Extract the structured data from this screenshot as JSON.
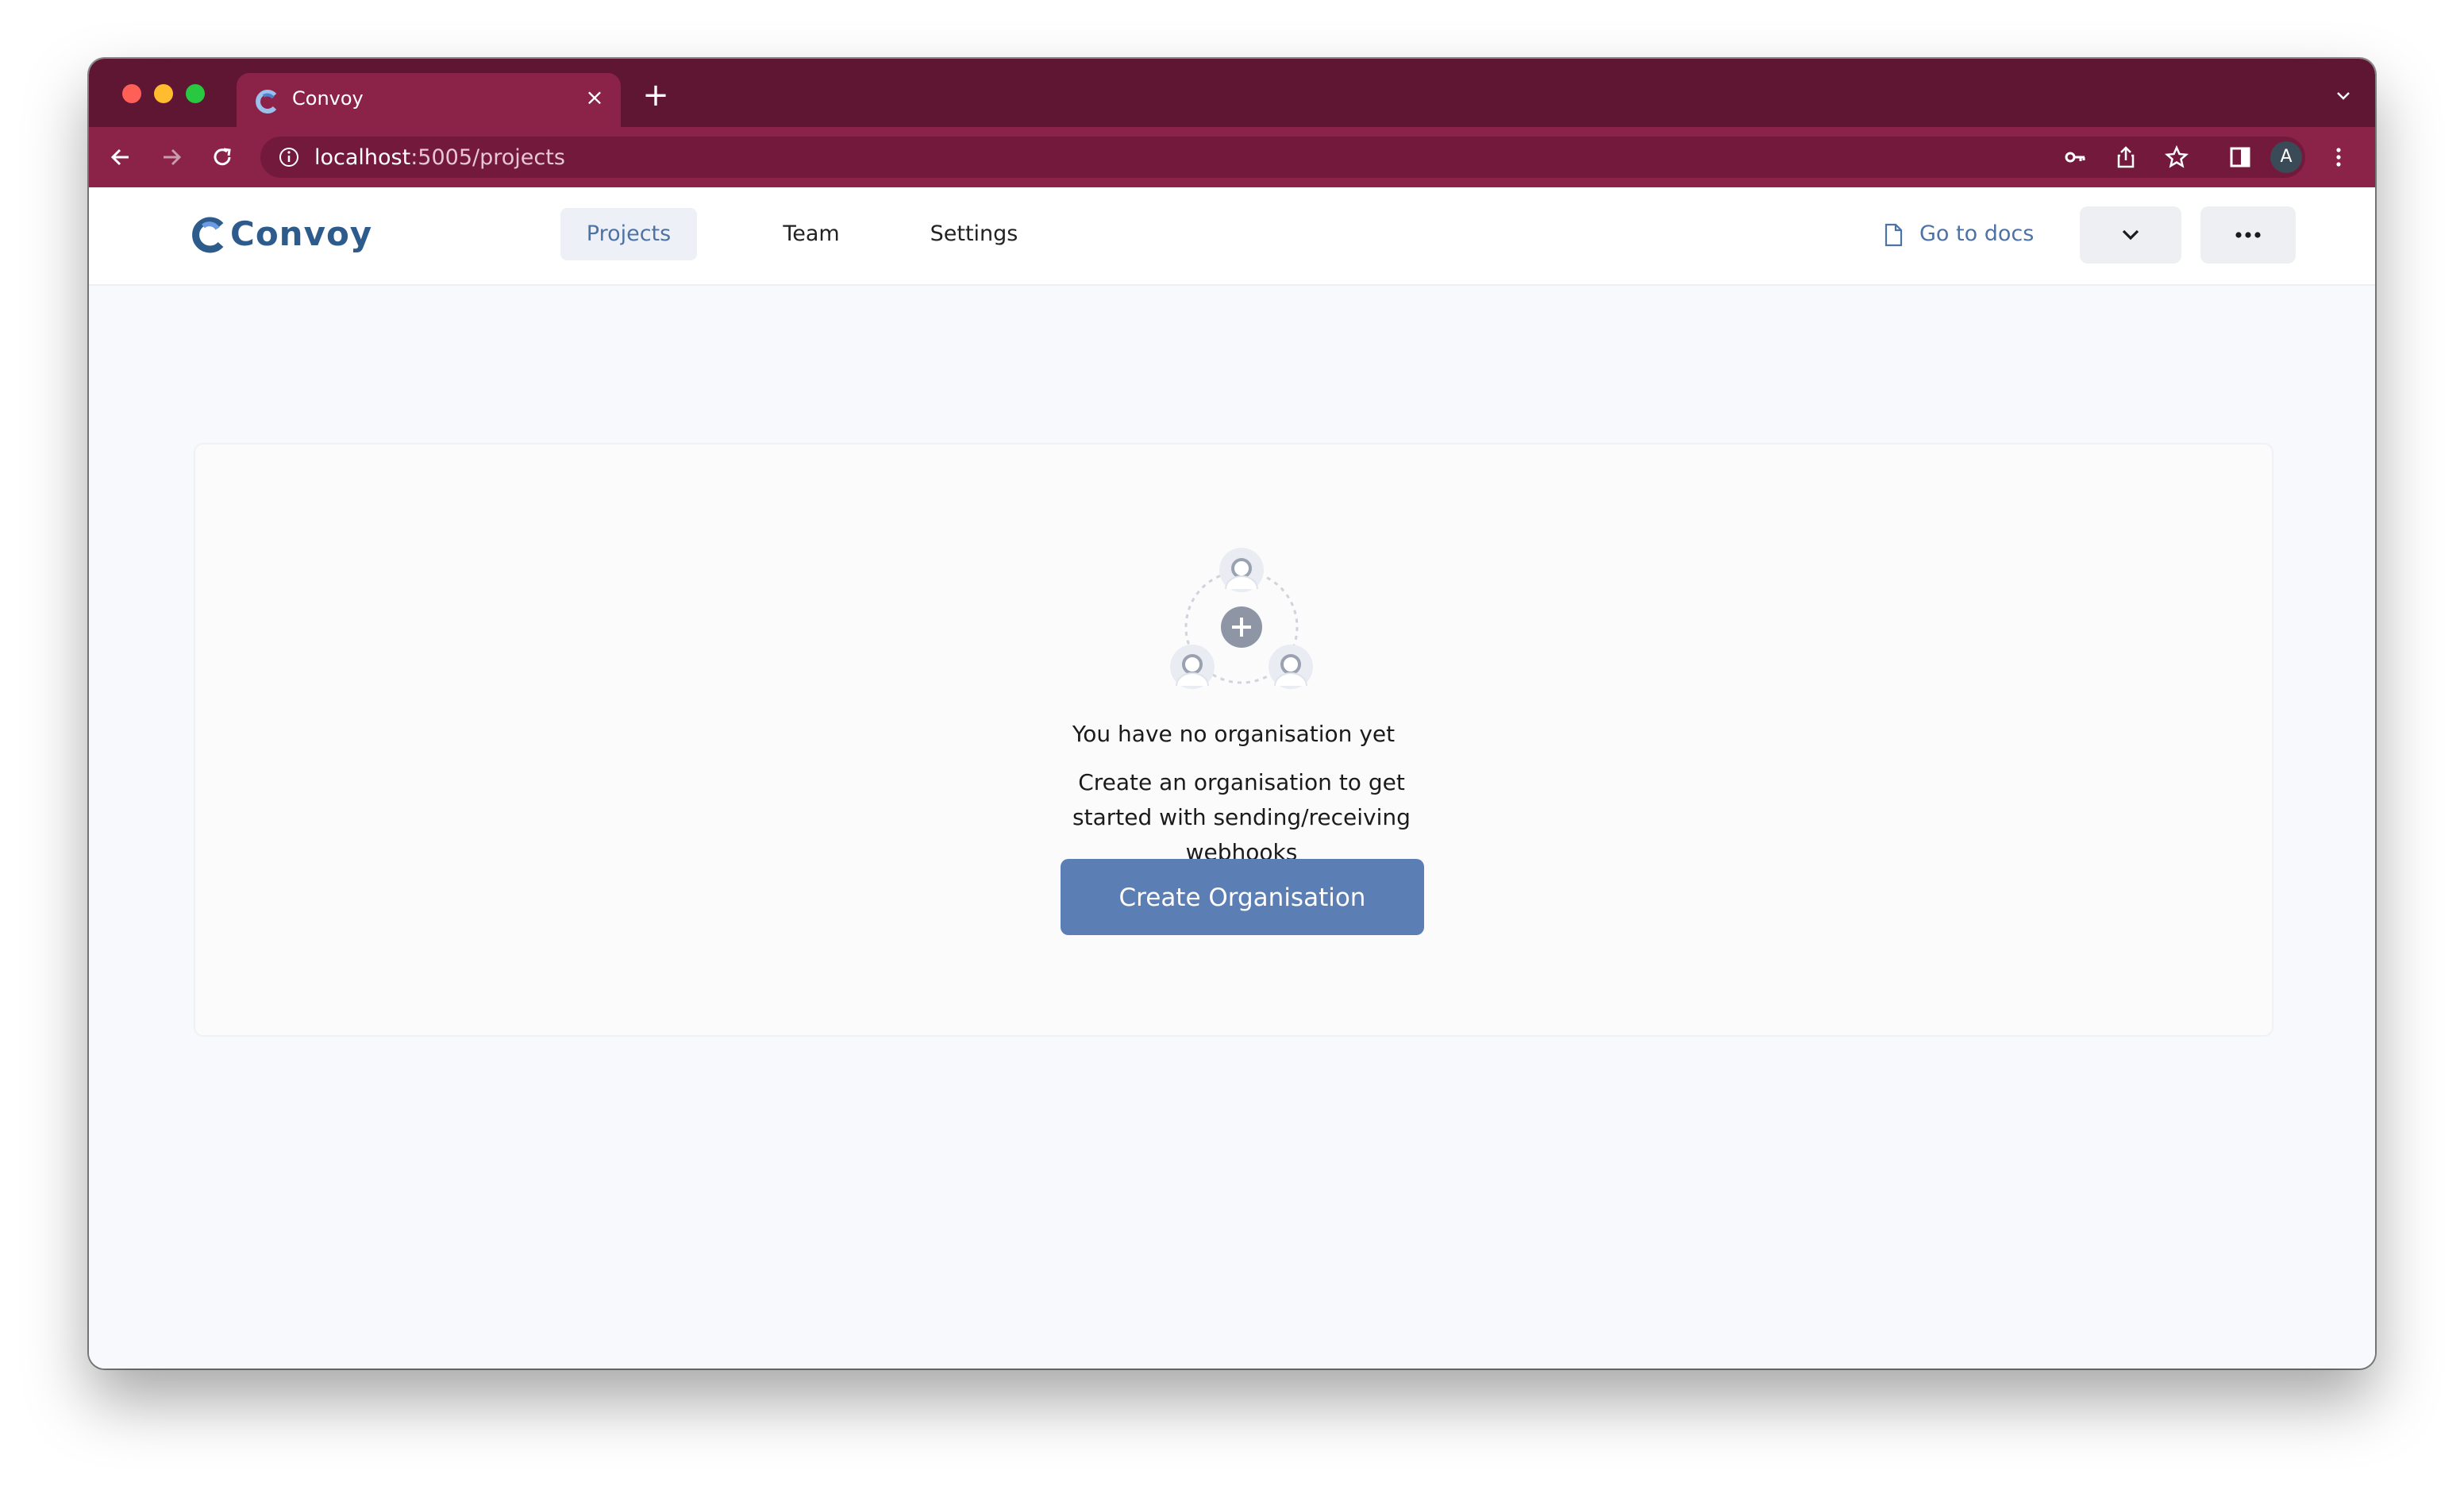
{
  "browser": {
    "tab_title": "Convoy",
    "tab_close": "×",
    "new_tab": "+",
    "url_host": "localhost",
    "url_rest": ":5005/projects",
    "profile_initial": "A"
  },
  "app": {
    "logo_text": "Convoy",
    "nav": {
      "projects": "Projects",
      "team": "Team",
      "settings": "Settings"
    },
    "docs_link": "Go to docs",
    "empty_state": {
      "title": "You have no organisation yet",
      "description": "Create an organisation to get started with sending/receiving webhooks",
      "button": "Create Organisation"
    }
  },
  "colors": {
    "titlebar": "#5e1632",
    "toolbar": "#8b2247",
    "brand": "#2d5b8c",
    "accent": "#5b7fb5",
    "active_nav_bg": "#edf1f7"
  },
  "icons": [
    "convoy-favicon-icon",
    "close-icon",
    "plus-icon",
    "back-arrow-icon",
    "forward-arrow-icon",
    "reload-icon",
    "info-icon",
    "key-icon",
    "share-icon",
    "star-icon",
    "side-panel-icon",
    "kebab-menu-icon",
    "document-icon",
    "chevron-down-icon",
    "more-horizontal-icon",
    "team-illustration-icon"
  ]
}
